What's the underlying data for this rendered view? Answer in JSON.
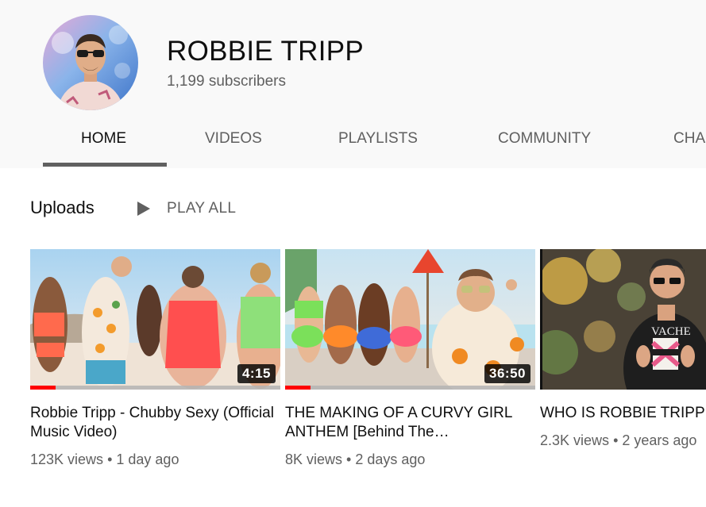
{
  "channel": {
    "name": "ROBBIE TRIPP",
    "subscribers": "1,199 subscribers",
    "avatar_icon": "channel-avatar-photo"
  },
  "tabs": [
    {
      "label": "HOME",
      "active": true
    },
    {
      "label": "VIDEOS",
      "active": false
    },
    {
      "label": "PLAYLISTS",
      "active": false
    },
    {
      "label": "COMMUNITY",
      "active": false
    },
    {
      "label": "CHA",
      "active": false
    }
  ],
  "uploads": {
    "title": "Uploads",
    "play_all_label": "PLAY ALL",
    "play_icon": "play-icon"
  },
  "videos": [
    {
      "title": "Robbie Tripp - Chubby Sexy (Official Music Video)",
      "duration": "4:15",
      "views": "123K views",
      "age": "1 day ago",
      "watched_fraction": 0.1
    },
    {
      "title": "THE MAKING OF A CURVY GIRL ANTHEM [Behind The…",
      "duration": "36:50",
      "views": "8K views",
      "age": "2 days ago",
      "watched_fraction": 0.1
    },
    {
      "title": "WHO IS ROBBIE TRIPP",
      "duration": "",
      "views": "2.3K views",
      "age": "2 years ago",
      "watched_fraction": 0
    }
  ],
  "colors": {
    "header_bg": "#f9f9f9",
    "progress_red": "#ff0000",
    "secondary_text": "#606060"
  }
}
